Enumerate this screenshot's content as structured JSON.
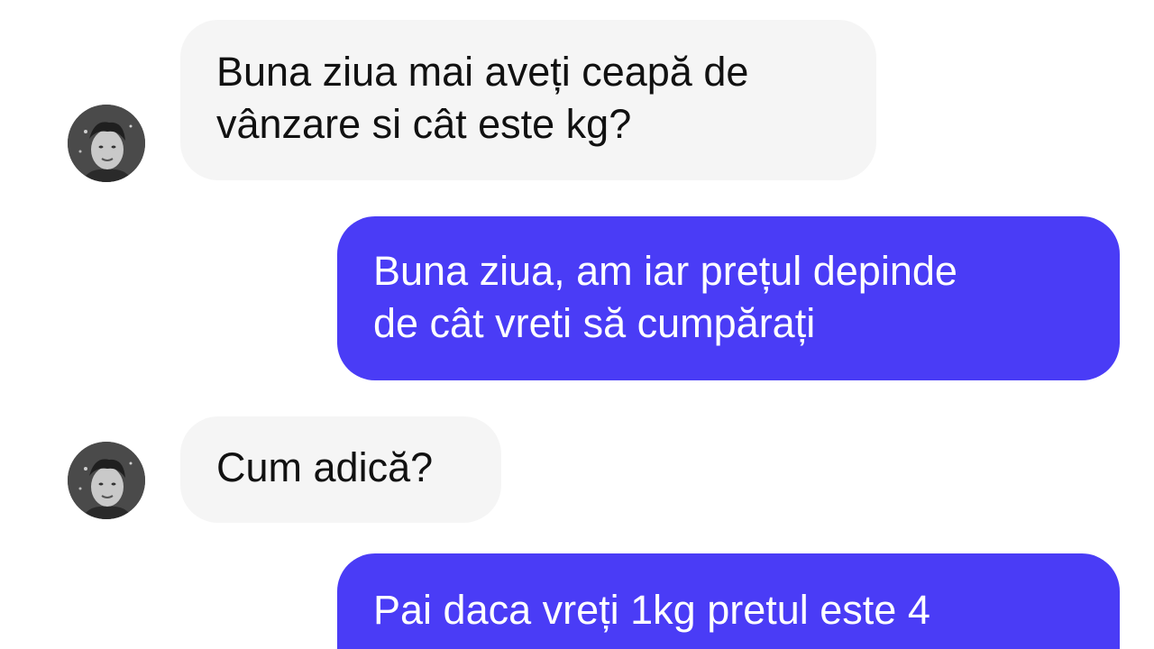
{
  "colors": {
    "incoming_bubble": "#f5f5f5",
    "outgoing_bubble": "#4a3cf6",
    "incoming_text": "#111111",
    "outgoing_text": "#ffffff"
  },
  "messages": [
    {
      "direction": "incoming",
      "avatar": "contact-avatar",
      "lines": [
        "Buna ziua mai aveți ceapă de",
        "vânzare si cât este kg?"
      ]
    },
    {
      "direction": "outgoing",
      "lines": [
        "Buna ziua, am iar prețul depinde",
        "de cât vreti să cumpărați"
      ]
    },
    {
      "direction": "incoming",
      "avatar": "contact-avatar",
      "lines": [
        "Cum adică?"
      ]
    },
    {
      "direction": "outgoing",
      "lines": [
        "Pai daca vreți 1kg pretul este 4"
      ]
    }
  ]
}
